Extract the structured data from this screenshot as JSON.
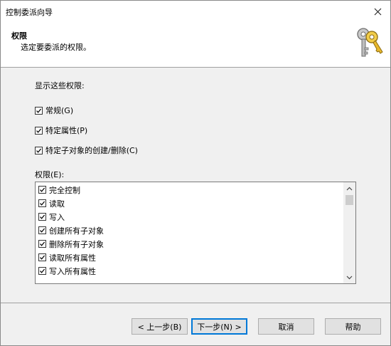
{
  "window": {
    "title": "控制委派向导",
    "close_glyph": "✕"
  },
  "header": {
    "title": "权限",
    "subtitle": "选定要委派的权限。",
    "icon": "keys-icon"
  },
  "filters": {
    "label": "显示这些权限:",
    "options": [
      {
        "label": "常规(G)",
        "checked": true
      },
      {
        "label": "特定属性(P)",
        "checked": true
      },
      {
        "label": "特定子对象的创建/删除(C)",
        "checked": true
      }
    ]
  },
  "permissions": {
    "label": "权限(E):",
    "items": [
      {
        "label": "完全控制",
        "checked": true
      },
      {
        "label": "读取",
        "checked": true
      },
      {
        "label": "写入",
        "checked": true
      },
      {
        "label": "创建所有子对象",
        "checked": true
      },
      {
        "label": "删除所有子对象",
        "checked": true
      },
      {
        "label": "读取所有属性",
        "checked": true
      },
      {
        "label": "写入所有属性",
        "checked": true
      }
    ]
  },
  "buttons": {
    "back": "< 上一步(B)",
    "next": "下一步(N) >",
    "cancel": "取消",
    "help": "帮助"
  },
  "colors": {
    "accent": "#0078d7",
    "dialog_bg": "#f0f0f0",
    "header_bg": "#ffffff"
  }
}
